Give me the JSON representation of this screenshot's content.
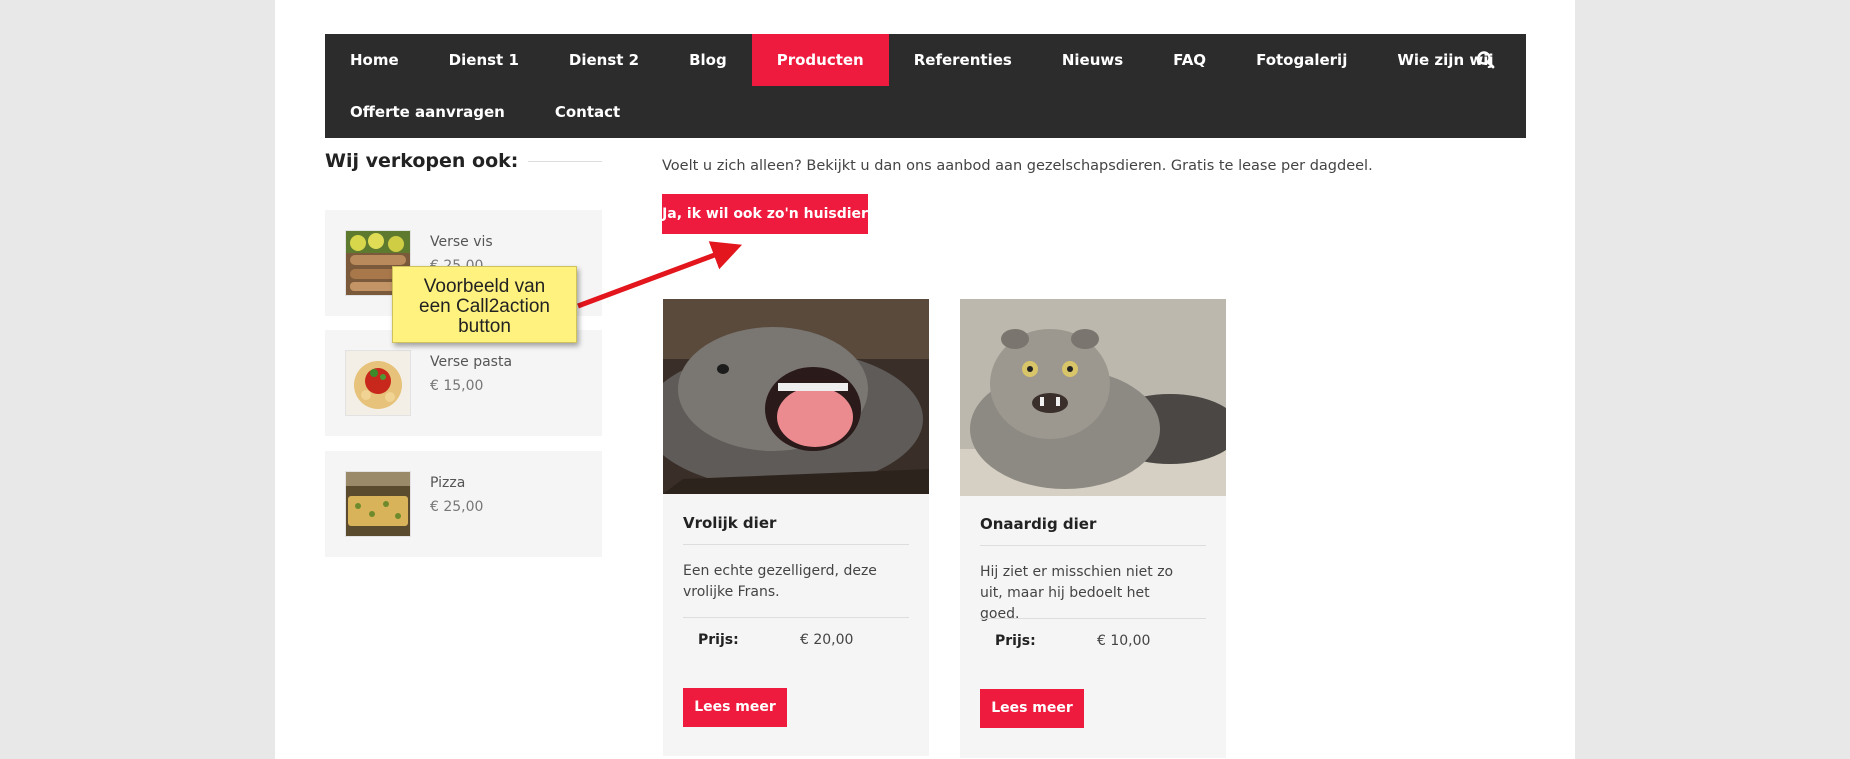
{
  "nav": {
    "row1": [
      "Home",
      "Dienst 1",
      "Dienst 2",
      "Blog",
      "Producten",
      "Referenties",
      "Nieuws",
      "FAQ",
      "Fotogalerij",
      "Wie zijn wij"
    ],
    "row2": [
      "Offerte aanvragen",
      "Contact"
    ],
    "active": "Producten",
    "search_icon": "search-icon"
  },
  "sidebar": {
    "title": "Wij verkopen ook:",
    "items": [
      {
        "name": "Verse vis",
        "price": "€ 25,00"
      },
      {
        "name": "Verse pasta",
        "price": "€ 15,00"
      },
      {
        "name": "Pizza",
        "price": "€ 25,00"
      }
    ]
  },
  "main": {
    "intro": "Voelt u zich alleen? Bekijkt u dan ons aanbod aan gezelschapsdieren. Gratis te lease per dagdeel.",
    "cta_label": "Ja, ik wil ook zo'n huisdier"
  },
  "products": [
    {
      "title": "Vrolijk dier",
      "desc": "Een echte gezelligerd, deze vrolijke Frans.",
      "price_label": "Prijs:",
      "price": "€ 20,00",
      "button": "Lees meer"
    },
    {
      "title": "Onaardig dier",
      "desc": "Hij ziet er misschien niet zo uit, maar hij bedoelt het goed.",
      "price_label": "Prijs:",
      "price": "€ 10,00",
      "button": "Lees meer"
    }
  ],
  "annotation": {
    "line1": "Voorbeeld van",
    "line2": "een Call2action",
    "line3": "button"
  },
  "colors": {
    "accent": "#ee1b3f",
    "nav_bg": "#2c2c2c",
    "callout_bg": "#fff27e",
    "arrow": "#e3161d"
  }
}
